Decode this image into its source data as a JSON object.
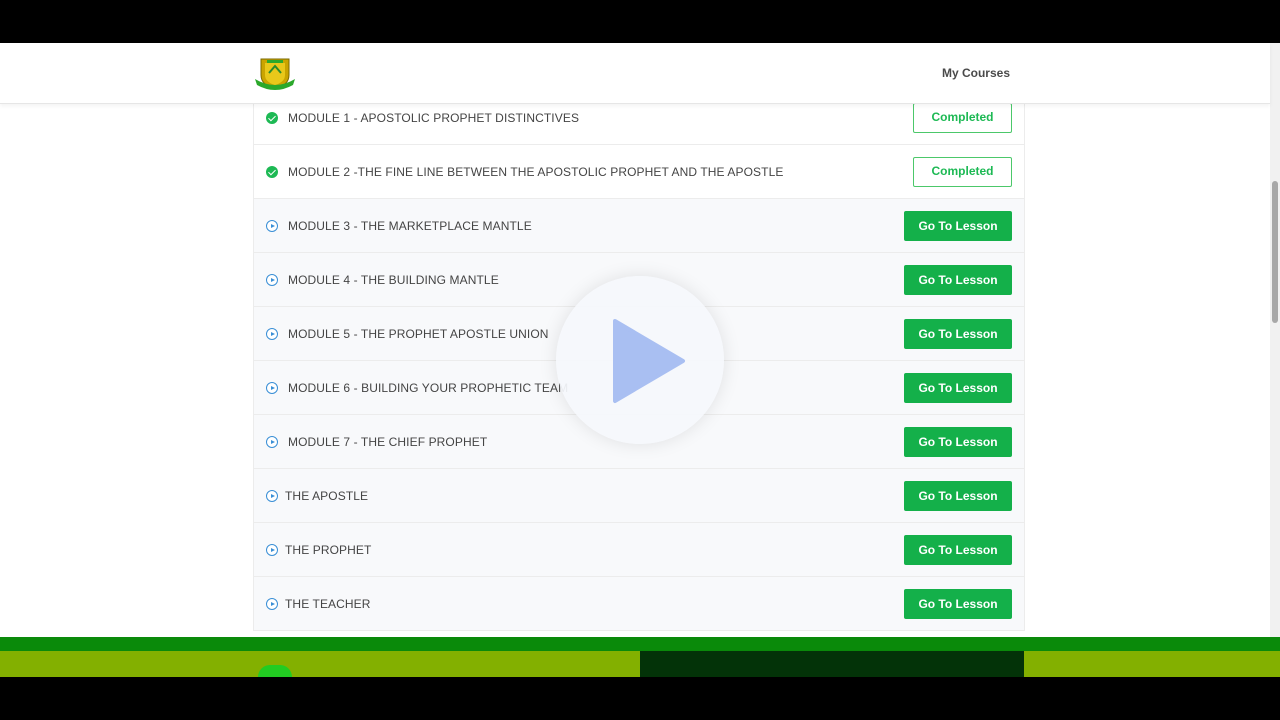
{
  "header": {
    "logo_alt": "logo",
    "nav_label": "My Courses"
  },
  "modules": [
    {
      "title": "MODULE 1 - APOSTOLIC PROPHET DISTINCTIVES",
      "status": "completed",
      "action": "Completed"
    },
    {
      "title": "MODULE 2 -THE FINE LINE BETWEEN THE APOSTOLIC PROPHET AND THE APOSTLE",
      "status": "completed",
      "action": "Completed"
    },
    {
      "title": "MODULE 3 - THE MARKETPLACE MANTLE",
      "status": "pending",
      "action": "Go To Lesson"
    },
    {
      "title": "MODULE 4 - THE BUILDING MANTLE",
      "status": "pending",
      "action": "Go To Lesson"
    },
    {
      "title": "MODULE 5 - THE PROPHET APOSTLE UNION",
      "status": "pending",
      "action": "Go To Lesson"
    },
    {
      "title": "MODULE 6 - BUILDING YOUR PROPHETIC TEAM",
      "status": "pending",
      "action": "Go To Lesson"
    },
    {
      "title": "MODULE 7 - THE CHIEF PROPHET",
      "status": "pending",
      "action": "Go To Lesson"
    },
    {
      "title": "THE APOSTLE",
      "status": "pending",
      "action": "Go To Lesson"
    },
    {
      "title": "THE PROPHET",
      "status": "pending",
      "action": "Go To Lesson"
    },
    {
      "title": "THE TEACHER",
      "status": "pending",
      "action": "Go To Lesson"
    }
  ],
  "colors": {
    "primary_green": "#14b04a",
    "check_green": "#1db954",
    "play_blue": "#3a8fd6",
    "overlay_play": "#a9bff2"
  },
  "icons": {
    "completed": "check-circle-icon",
    "pending": "play-circle-icon",
    "overlay": "play-icon"
  }
}
